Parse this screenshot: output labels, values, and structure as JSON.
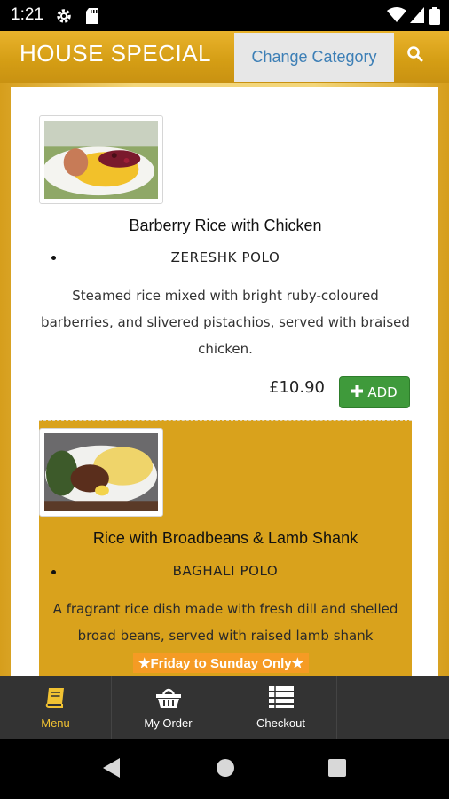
{
  "status_bar": {
    "time": "1:21"
  },
  "header": {
    "title": "HOUSE SPECIAL",
    "change_category": "Change Category"
  },
  "items": [
    {
      "name": "Barberry Rice with Chicken",
      "subtitle": "ZERESHK POLO",
      "description": "Steamed rice mixed with bright ruby-coloured barberries, and slivered pistachios, served with braised chicken.",
      "price": "£10.90",
      "add_label": "ADD"
    },
    {
      "name": "Rice with Broadbeans & Lamb Shank",
      "subtitle": "BAGHALI POLO",
      "description": "A fragrant rice dish made with fresh dill and shelled broad beans, served with raised lamb shank",
      "promo": "★Friday to Sunday Only★"
    }
  ],
  "bottom_nav": [
    {
      "label": "Menu",
      "icon": "menu-book-icon",
      "active": true
    },
    {
      "label": "My Order",
      "icon": "basket-icon",
      "active": false
    },
    {
      "label": "Checkout",
      "icon": "list-icon",
      "active": false
    }
  ],
  "colors": {
    "header_gold": "#d49d14",
    "highlight_item": "#d9a21c",
    "add_green": "#3f9a3b",
    "active_nav": "#f1c232",
    "promo_orange": "#f59b24",
    "link_blue": "#3d7fb6"
  }
}
